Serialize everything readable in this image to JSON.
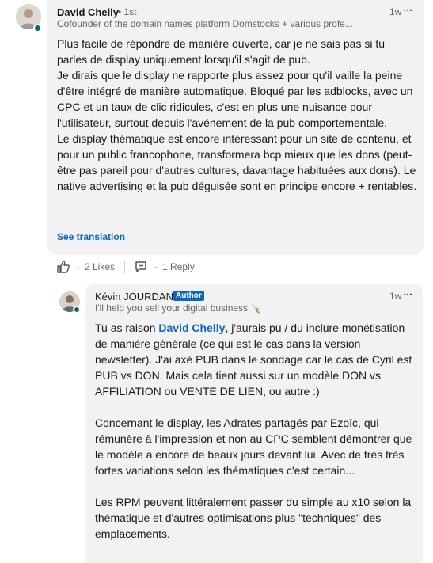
{
  "comment": {
    "author_name": "David Chelly",
    "degree": "• 1st",
    "headline": "Cofounder of the domain names platform Domstocks + various profe...",
    "time": "1w",
    "more": "•••",
    "body": "Plus facile de répondre de manière ouverte, car je ne sais pas si tu parles de display uniquement lorsqu'il s'agit de pub.\nJe dirais que le display ne rapporte plus assez pour qu'il vaille la peine d'être intégré de manière automatique. Bloqué par les adblocks, avec un CPC et un taux de clic ridicules, c'est en plus une nuisance pour l'utilisateur, surtout depuis l'avénement de la pub comportementale.\nLe display thématique est encore intéressant pour un site de contenu, et pour un public francophone, transformera bcp mieux que les dons (peut-être pas pareil pour d'autres cultures, davantage habituées aux dons). Le native advertising et la pub déguisée sont en principe encore + rentables.",
    "see_translation": "See translation",
    "likes_label": "2 Likes",
    "replies_label": "1 Reply",
    "dot": "·",
    "like_icon": "thumbs-up-icon",
    "reply_icon": "speech-bubble-icon"
  },
  "reply": {
    "author_name": "Kévin JOURDAN",
    "author_badge": "Author",
    "headline": "I'll help you sell your digital business 🍾",
    "time": "1w",
    "more": "•••",
    "mention": "David Chelly",
    "body_after_mention": ", j'aurais pu / du inclure monétisation de manière générale (ce qui est le cas dans la version newsletter). J'ai axé PUB dans le sondage car le cas de Cyril est PUB vs DON. Mais cela tient aussi sur un modèle DON vs AFFILIATION ou VENTE DE LIEN, ou autre :)\n\nConcernant le display, les Adrates partagés par Ezoïc, qui rémunère à l'impression et non au CPC semblent démontrer que le modèle a encore de beaux jours devant lui. Avec de très très fortes variations selon les thématiques c'est certain...\n\nLes RPM peuvent littéralement passer du simple au x10 selon la thématique et d'autres optimisations plus \"techniques\" des emplacements.",
    "body_before_mention": "Tu as raison "
  },
  "colors": {
    "accent": "#0a66c2",
    "bubble": "#f2f2f2",
    "presence": "#057642"
  }
}
